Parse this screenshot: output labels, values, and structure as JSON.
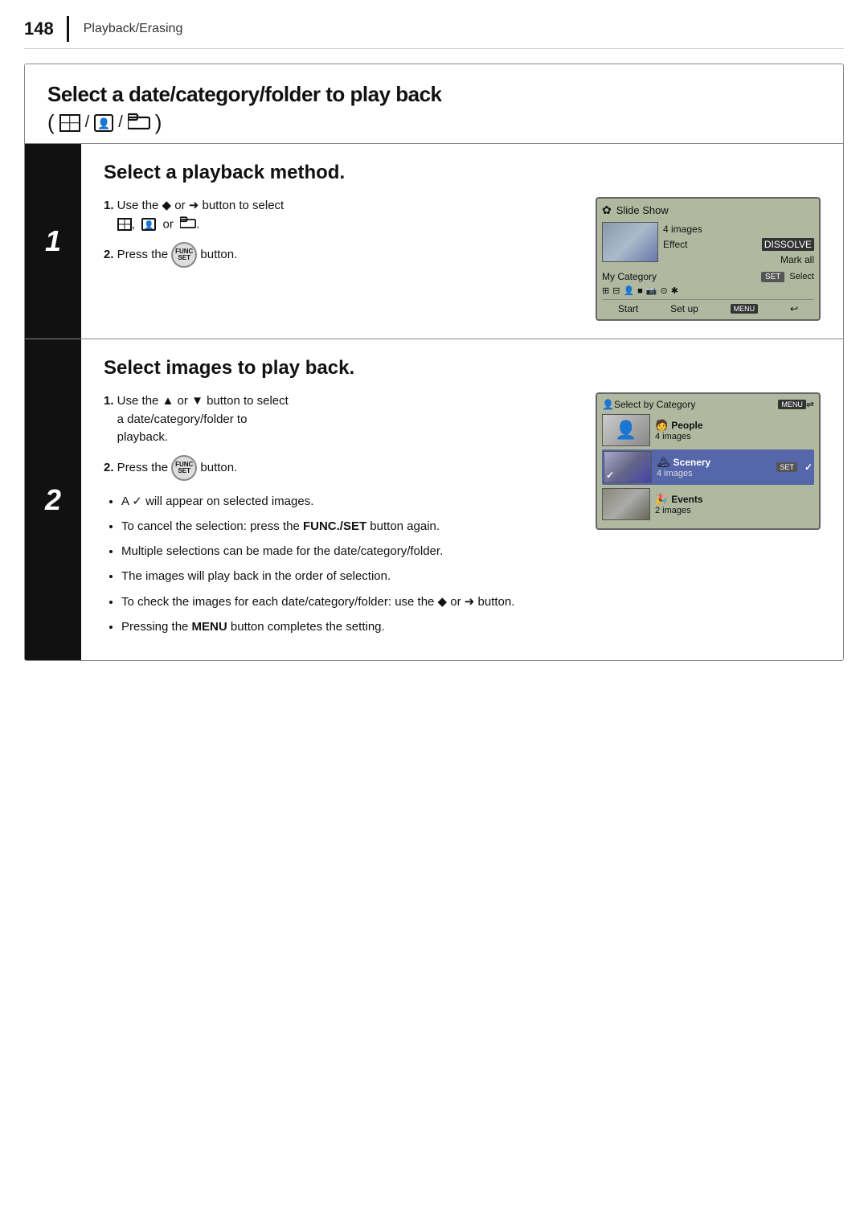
{
  "header": {
    "page_number": "148",
    "section": "Playback/Erasing",
    "bar_char": "|"
  },
  "main_title": {
    "heading": "Select a date/category/folder to play back",
    "icons_label": "(grid/face/folder)"
  },
  "step1": {
    "number": "1",
    "title": "Select a playback method.",
    "instructions": [
      {
        "num": "1.",
        "text_parts": [
          {
            "text": "Use the ",
            "bold": false
          },
          {
            "text": "◆",
            "bold": false
          },
          {
            "text": " or ",
            "bold": false
          },
          {
            "text": "➜",
            "bold": false
          },
          {
            "text": " button to select",
            "bold": false
          }
        ],
        "second_line": "grid, face or folder."
      },
      {
        "num": "2.",
        "text_parts": [
          {
            "text": "Press the ",
            "bold": false
          },
          {
            "text": "FUNC/SET",
            "bold": false
          },
          {
            "text": " button.",
            "bold": false
          }
        ]
      }
    ],
    "screen": {
      "title": "Slide Show",
      "count": "4 images",
      "effect_label": "Effect",
      "effect_value": "DISSOLVE",
      "mark_all": "Mark all",
      "category_label": "My Category",
      "category_action": "SET Select",
      "icons": [
        "grid",
        "face",
        "video",
        "star",
        "camera",
        "asterisk"
      ],
      "start": "Start",
      "setup": "Set up",
      "menu": "MENU"
    }
  },
  "step2": {
    "number": "2",
    "title": "Select images to play back.",
    "instructions": [
      {
        "num": "1.",
        "text_parts": [
          {
            "text": "Use the ",
            "bold": false
          },
          {
            "text": "▲",
            "bold": false
          },
          {
            "text": " or ",
            "bold": false
          },
          {
            "text": "▼",
            "bold": false
          },
          {
            "text": " button to select",
            "bold": false
          }
        ],
        "second_line": "a date/category/folder to",
        "third_line": "playback."
      },
      {
        "num": "2.",
        "text_parts": [
          {
            "text": "Press the ",
            "bold": false
          },
          {
            "text": "FUNC/SET",
            "bold": false
          },
          {
            "text": " button.",
            "bold": false
          }
        ]
      }
    ],
    "screen": {
      "header_label": "Select by Category",
      "menu_icon": "MENU",
      "rows": [
        {
          "category": "People",
          "count": "4 images",
          "selected": false,
          "checked": false
        },
        {
          "category": "Scenery",
          "count": "4 images",
          "selected": true,
          "checked": true
        },
        {
          "category": "Events",
          "count": "2 images",
          "selected": false,
          "checked": false
        }
      ]
    },
    "bullets": [
      {
        "text_parts": [
          {
            "text": "A ✓ will appear on selected images.",
            "bold": false
          }
        ]
      },
      {
        "text_parts": [
          {
            "text": "To cancel the selection: press the ",
            "bold": false
          },
          {
            "text": "FUNC./SET",
            "bold": true
          },
          {
            "text": " button again.",
            "bold": false
          }
        ]
      },
      {
        "text_parts": [
          {
            "text": "Multiple selections can be made for the date/category/folder.",
            "bold": false
          }
        ]
      },
      {
        "text_parts": [
          {
            "text": "The images will play back in the order of selection.",
            "bold": false
          }
        ]
      },
      {
        "text_parts": [
          {
            "text": "To check the images for each date/category/folder: use the ◆ or ➜ button.",
            "bold": false
          }
        ]
      },
      {
        "text_parts": [
          {
            "text": "Pressing the ",
            "bold": false
          },
          {
            "text": "MENU",
            "bold": true
          },
          {
            "text": " button completes the setting.",
            "bold": false
          }
        ]
      }
    ]
  }
}
